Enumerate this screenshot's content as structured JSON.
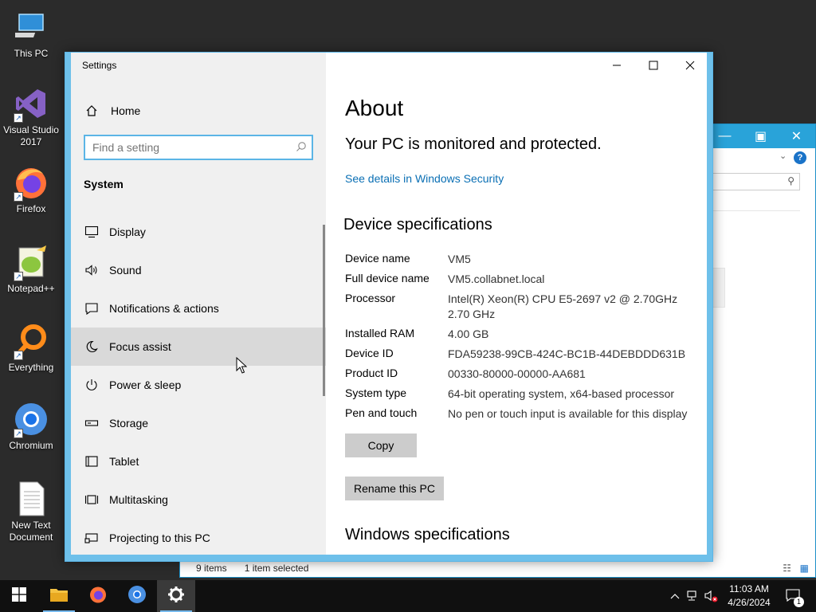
{
  "desktop": {
    "icons": [
      {
        "label": "This PC",
        "icon": "computer-icon"
      },
      {
        "label": "Visual Studio 2017",
        "icon": "visual-studio-icon"
      },
      {
        "label": "Firefox",
        "icon": "firefox-icon"
      },
      {
        "label": "Notepad++",
        "icon": "notepad-plus-plus-icon"
      },
      {
        "label": "Everything",
        "icon": "everything-search-icon"
      },
      {
        "label": "Chromium",
        "icon": "chromium-icon"
      },
      {
        "label": "New Text Document",
        "icon": "text-document-icon"
      }
    ]
  },
  "explorer": {
    "status_items": "9 items",
    "status_selected": "1 item selected"
  },
  "settings": {
    "title": "Settings",
    "home_label": "Home",
    "search_placeholder": "Find a setting",
    "section": "System",
    "nav_items": [
      {
        "label": "Display",
        "icon": "display-icon"
      },
      {
        "label": "Sound",
        "icon": "speaker-icon"
      },
      {
        "label": "Notifications & actions",
        "icon": "notification-icon"
      },
      {
        "label": "Focus assist",
        "icon": "moon-icon",
        "active": true
      },
      {
        "label": "Power & sleep",
        "icon": "power-icon"
      },
      {
        "label": "Storage",
        "icon": "storage-icon"
      },
      {
        "label": "Tablet",
        "icon": "tablet-icon"
      },
      {
        "label": "Multitasking",
        "icon": "multitasking-icon"
      },
      {
        "label": "Projecting to this PC",
        "icon": "projecting-icon"
      }
    ],
    "content": {
      "heading": "About",
      "protection_status": "Your PC is monitored and protected.",
      "security_link": "See details in Windows Security",
      "device_specs_heading": "Device specifications",
      "specs": [
        {
          "key": "Device name",
          "value": "VM5"
        },
        {
          "key": "Full device name",
          "value": "VM5.collabnet.local"
        },
        {
          "key": "Processor",
          "value": "Intel(R) Xeon(R) CPU E5-2697 v2 @ 2.70GHz 2.70 GHz"
        },
        {
          "key": "Installed RAM",
          "value": "4.00 GB"
        },
        {
          "key": "Device ID",
          "value": "FDA59238-99CB-424C-BC1B-44DEBDDD631B"
        },
        {
          "key": "Product ID",
          "value": "00330-80000-00000-AA681"
        },
        {
          "key": "System type",
          "value": "64-bit operating system, x64-based processor"
        },
        {
          "key": "Pen and touch",
          "value": "No pen or touch input is available for this display"
        }
      ],
      "copy_button": "Copy",
      "rename_button": "Rename this PC",
      "windows_specs_heading": "Windows specifications"
    }
  },
  "taskbar": {
    "apps": [
      "start-icon",
      "file-explorer-icon",
      "firefox-icon",
      "chromium-icon",
      "settings-gear-icon"
    ],
    "time": "11:03 AM",
    "date": "4/26/2024",
    "notification_count": "1"
  },
  "colors": {
    "accent": "#29a3d9",
    "link": "#0a6fb4",
    "nav_bg": "#f0f0f0",
    "active_item": "#d9d9d9"
  }
}
